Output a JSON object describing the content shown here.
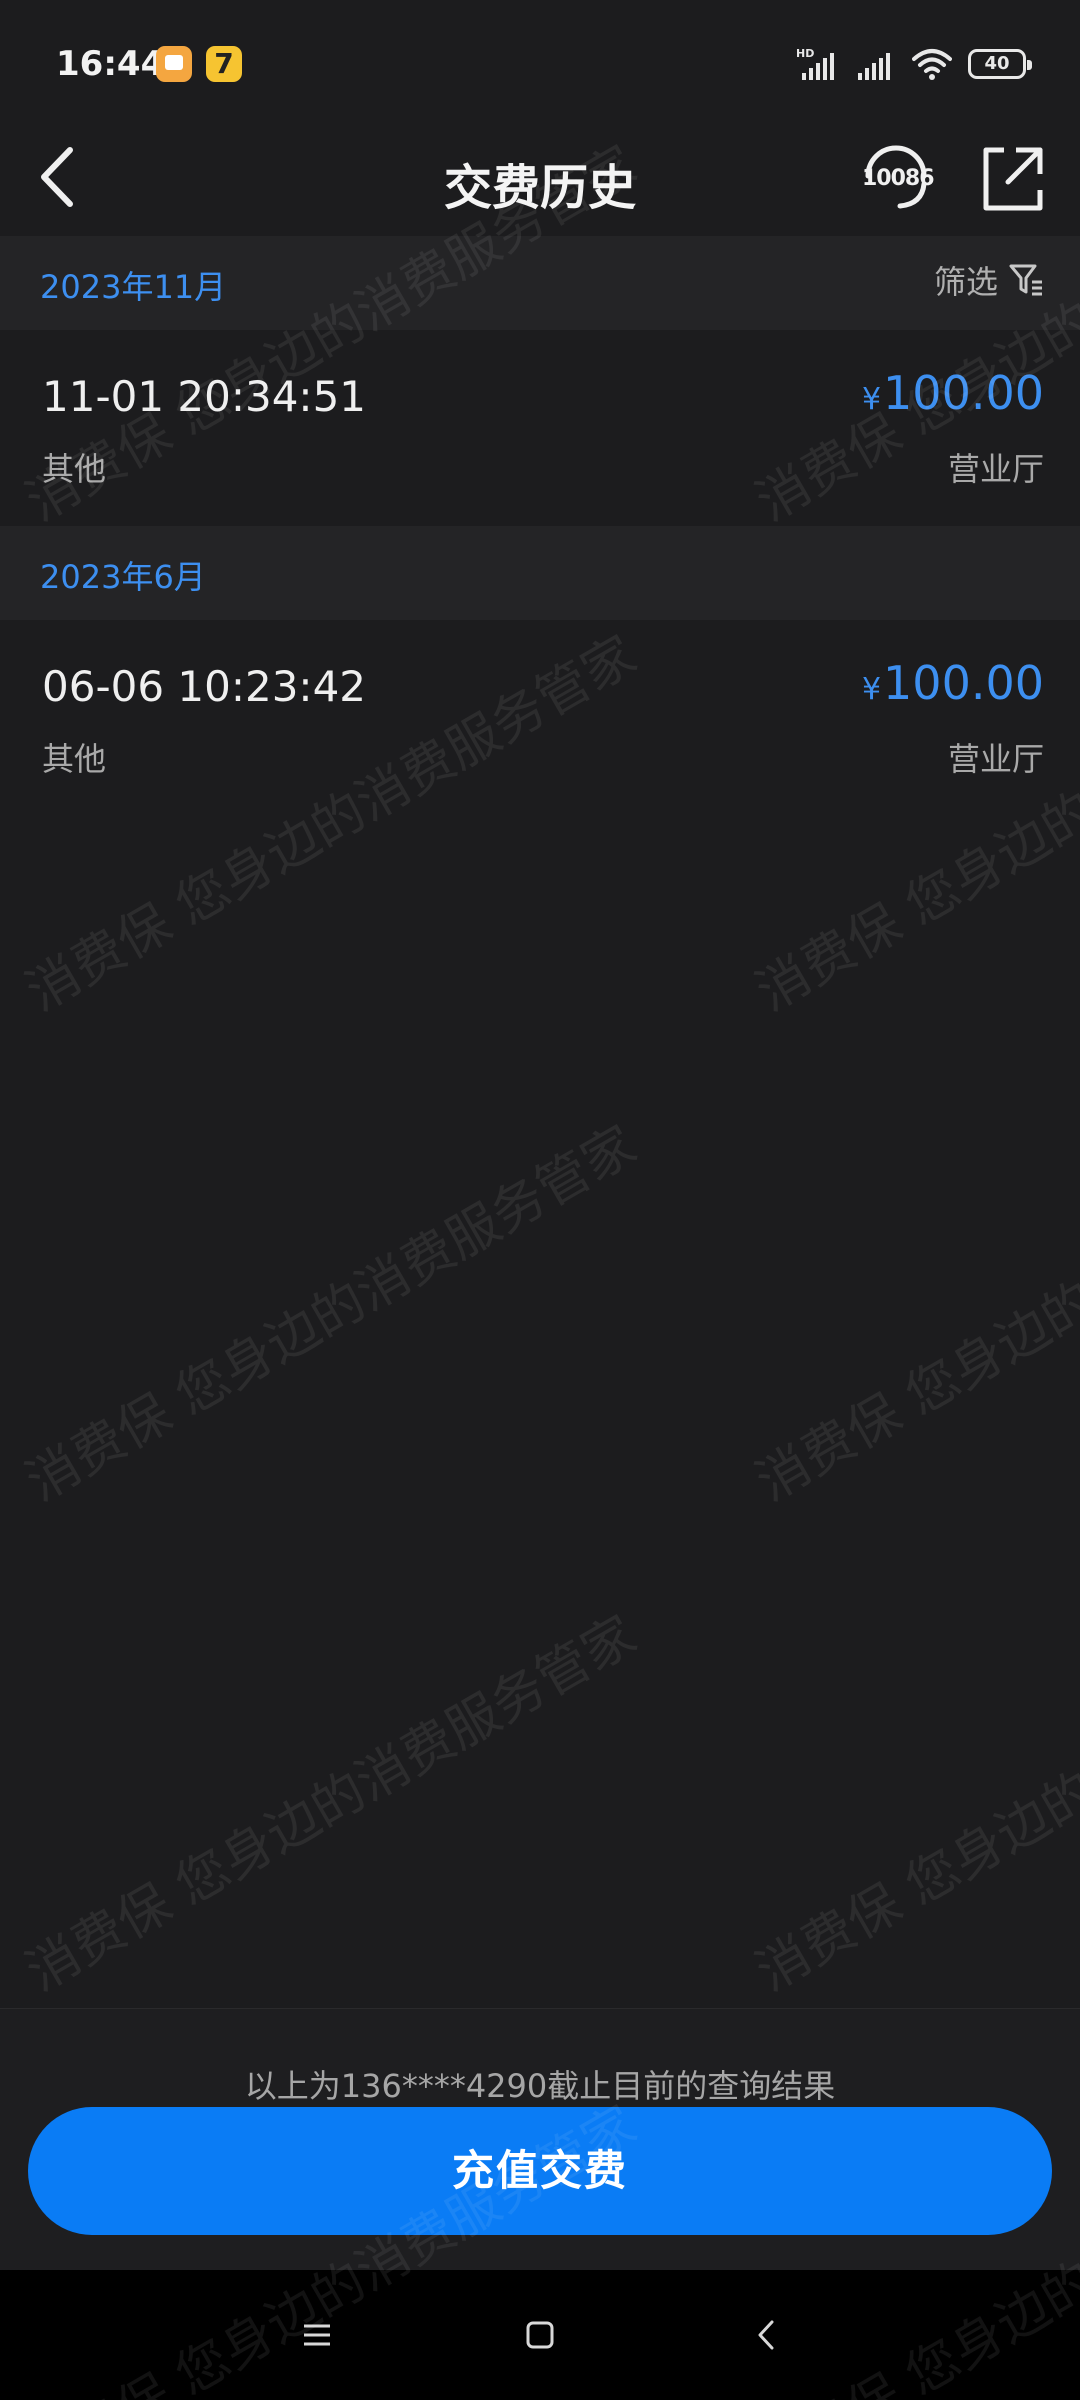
{
  "status_bar": {
    "time": "16:44",
    "notification_badge": "7",
    "network_label": "HD",
    "battery": "40",
    "icons": [
      "message-app-icon",
      "video-app-icon",
      "signal-icon",
      "wifi-icon",
      "battery-icon"
    ]
  },
  "header": {
    "title": "交费历史",
    "hotline": "10086",
    "icons": [
      "back-arrow-icon",
      "customer-service-icon",
      "share-icon"
    ]
  },
  "sections": [
    {
      "month": "2023年11月",
      "filter_label": "筛选",
      "records": [
        {
          "time": "11-01 20:34:51",
          "type": "其他",
          "currency": "¥",
          "amount": "100.00",
          "channel": "营业厅"
        }
      ]
    },
    {
      "month": "2023年6月",
      "records": [
        {
          "time": "06-06 10:23:42",
          "type": "其他",
          "currency": "¥",
          "amount": "100.00",
          "channel": "营业厅"
        }
      ]
    }
  ],
  "footer": {
    "note": "以上为136****4290截止目前的查询结果",
    "recharge_button": "充值交费"
  },
  "watermark": {
    "line_a": "消费保 您身边的消费服务管家",
    "line_b": "消费保 您身边的消费服务管家"
  },
  "colors": {
    "accent": "#3d8ff0",
    "button": "#0a7cf5",
    "background": "#1c1c1e",
    "section_background": "#242426"
  }
}
